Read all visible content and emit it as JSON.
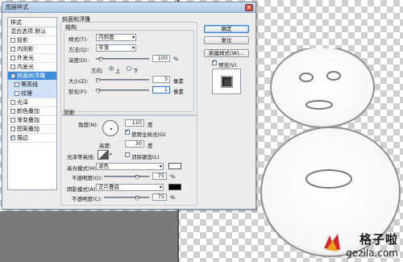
{
  "dialog": {
    "title": "图层样式",
    "close_glyph": "x"
  },
  "styles_panel": {
    "header": "样式",
    "items": [
      {
        "label": "混合选项:默认",
        "checked": false,
        "checkbox": false
      },
      {
        "label": "投影",
        "checked": false,
        "checkbox": true
      },
      {
        "label": "内阴影",
        "checked": false,
        "checkbox": true
      },
      {
        "label": "外发光",
        "checked": false,
        "checkbox": true
      },
      {
        "label": "内发光",
        "checked": false,
        "checkbox": true
      },
      {
        "label": "斜面和浮雕",
        "checked": true,
        "checkbox": true,
        "selected": true
      },
      {
        "label": "等高线",
        "checked": false,
        "checkbox": true,
        "sub": true
      },
      {
        "label": "纹理",
        "checked": false,
        "checkbox": true,
        "sub": true
      },
      {
        "label": "光泽",
        "checked": false,
        "checkbox": true
      },
      {
        "label": "颜色叠加",
        "checked": false,
        "checkbox": true
      },
      {
        "label": "渐变叠加",
        "checked": false,
        "checkbox": true
      },
      {
        "label": "图案叠加",
        "checked": false,
        "checkbox": true
      },
      {
        "label": "描边",
        "checked": true,
        "checkbox": true
      }
    ]
  },
  "bevel": {
    "section_title": "斜面和浮雕",
    "structure_title": "结构",
    "style_label": "样式(T):",
    "style_value": "内斜面",
    "technique_label": "方法(Q):",
    "technique_value": "平滑",
    "depth_label": "深度(D):",
    "depth_value": "100",
    "depth_fraction": 0.1,
    "depth_unit": "%",
    "direction_label": "方向:",
    "direction_up": "上",
    "direction_down": "下",
    "direction_selected": "up",
    "size_label": "大小(Z):",
    "size_value": "3",
    "size_unit": "像素",
    "size_fraction": 0.04,
    "soften_label": "软化(F):",
    "soften_value": "1",
    "soften_unit": "像素",
    "soften_fraction": 0.05
  },
  "shading": {
    "section_title": "阴影",
    "angle_label": "角度(N):",
    "angle_value": "120",
    "angle_unit": "度",
    "global_light_label": "使用全局光(G)",
    "global_light_checked": true,
    "altitude_label": "高度:",
    "altitude_value": "30",
    "altitude_unit": "度",
    "gloss_label": "光泽等高线:",
    "antialias_label": "消除锯齿(L)",
    "antialias_checked": false,
    "highlight_label": "高光模式(H):",
    "highlight_mode": "滤色",
    "highlight_color": "#ffffff",
    "highlight_opacity_label": "不透明度(O):",
    "highlight_opacity": "75",
    "highlight_opacity_fraction": 0.75,
    "shadow_label": "阴影模式(A):",
    "shadow_mode": "正片叠底",
    "shadow_color": "#000000",
    "shadow_opacity_label": "不透明度(C):",
    "shadow_opacity": "75",
    "shadow_opacity_fraction": 0.75,
    "percent": "%"
  },
  "buttons": {
    "ok": "确定",
    "reset": "复位",
    "new_style": "新建样式(W)...",
    "preview_label": "预览(V)",
    "preview_checked": true
  },
  "watermark": {
    "title": "格子啦",
    "url": "gezila.com",
    "icon": "gezila-logo-icon"
  },
  "colors": {
    "selection": "#3b8de0",
    "dialog_bg": "#ececec"
  }
}
